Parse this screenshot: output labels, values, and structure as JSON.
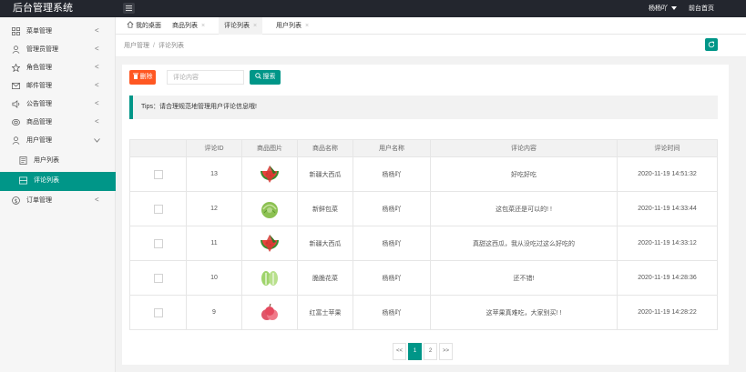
{
  "header": {
    "brand": "后台管理系统",
    "user": "杨杨吖",
    "home_link": "前台首页"
  },
  "sidebar": {
    "items": [
      {
        "label": "菜单管理",
        "icon": "grid-icon",
        "arrow": "<"
      },
      {
        "label": "管理员管理",
        "icon": "user-admin-icon",
        "arrow": "<"
      },
      {
        "label": "角色管理",
        "icon": "star-icon",
        "arrow": "<"
      },
      {
        "label": "邮件管理",
        "icon": "mail-icon",
        "arrow": "<"
      },
      {
        "label": "公告管理",
        "icon": "speaker-icon",
        "arrow": "<"
      },
      {
        "label": "商品管理",
        "icon": "goods-icon",
        "arrow": "<"
      },
      {
        "label": "用户管理",
        "icon": "user-icon",
        "arrow": "v"
      },
      {
        "label": "用户列表",
        "icon": "list-icon"
      },
      {
        "label": "评论列表",
        "icon": "comment-list-icon"
      },
      {
        "label": "订单管理",
        "icon": "dollar-icon",
        "arrow": "<"
      }
    ]
  },
  "tabs": [
    {
      "label": "我的桌面",
      "icon": "home-icon"
    },
    {
      "label": "商品列表",
      "close": "×"
    },
    {
      "label": "评论列表",
      "close": "×"
    },
    {
      "label": "用户列表",
      "close": "×"
    }
  ],
  "breadcrumb": {
    "parent": "用户管理",
    "separator": "/",
    "current": "评论列表"
  },
  "toolbar": {
    "delete_label": "删除",
    "search_placeholder": "评论内容",
    "search_label": "搜索"
  },
  "tips": "Tips：请合理规范地管理用户评论信息哦!",
  "table": {
    "headers": [
      "",
      "评论ID",
      "商品图片",
      "商品名称",
      "用户名称",
      "评论内容",
      "评论时间"
    ],
    "rows": [
      {
        "id": "13",
        "image": "watermelon",
        "product": "新疆大西瓜",
        "user": "杨杨吖",
        "content": "好吃好吃",
        "time": "2020-11-19 14:51:32"
      },
      {
        "id": "12",
        "image": "cabbage",
        "product": "新鲜包菜",
        "user": "杨杨吖",
        "content": "这包菜还是可以的! !",
        "time": "2020-11-19 14:33:44"
      },
      {
        "id": "11",
        "image": "watermelon",
        "product": "新疆大西瓜",
        "user": "杨杨吖",
        "content": "真甜这西瓜，我从没吃过这么好吃的",
        "time": "2020-11-19 14:33:12"
      },
      {
        "id": "10",
        "image": "broccoli",
        "product": "脆脆花菜",
        "user": "杨杨吖",
        "content": "还不错!",
        "time": "2020-11-19 14:28:36"
      },
      {
        "id": "9",
        "image": "apple",
        "product": "红富士苹果",
        "user": "杨杨吖",
        "content": "这苹果真难吃，大家别买! !",
        "time": "2020-11-19 14:28:22"
      }
    ]
  },
  "pagination": {
    "prev": "<<",
    "pages": [
      "1",
      "2"
    ],
    "next": ">>",
    "current": "1"
  },
  "colors": {
    "accent": "#009688",
    "danger": "#ff5722",
    "topbar": "#23262e"
  }
}
